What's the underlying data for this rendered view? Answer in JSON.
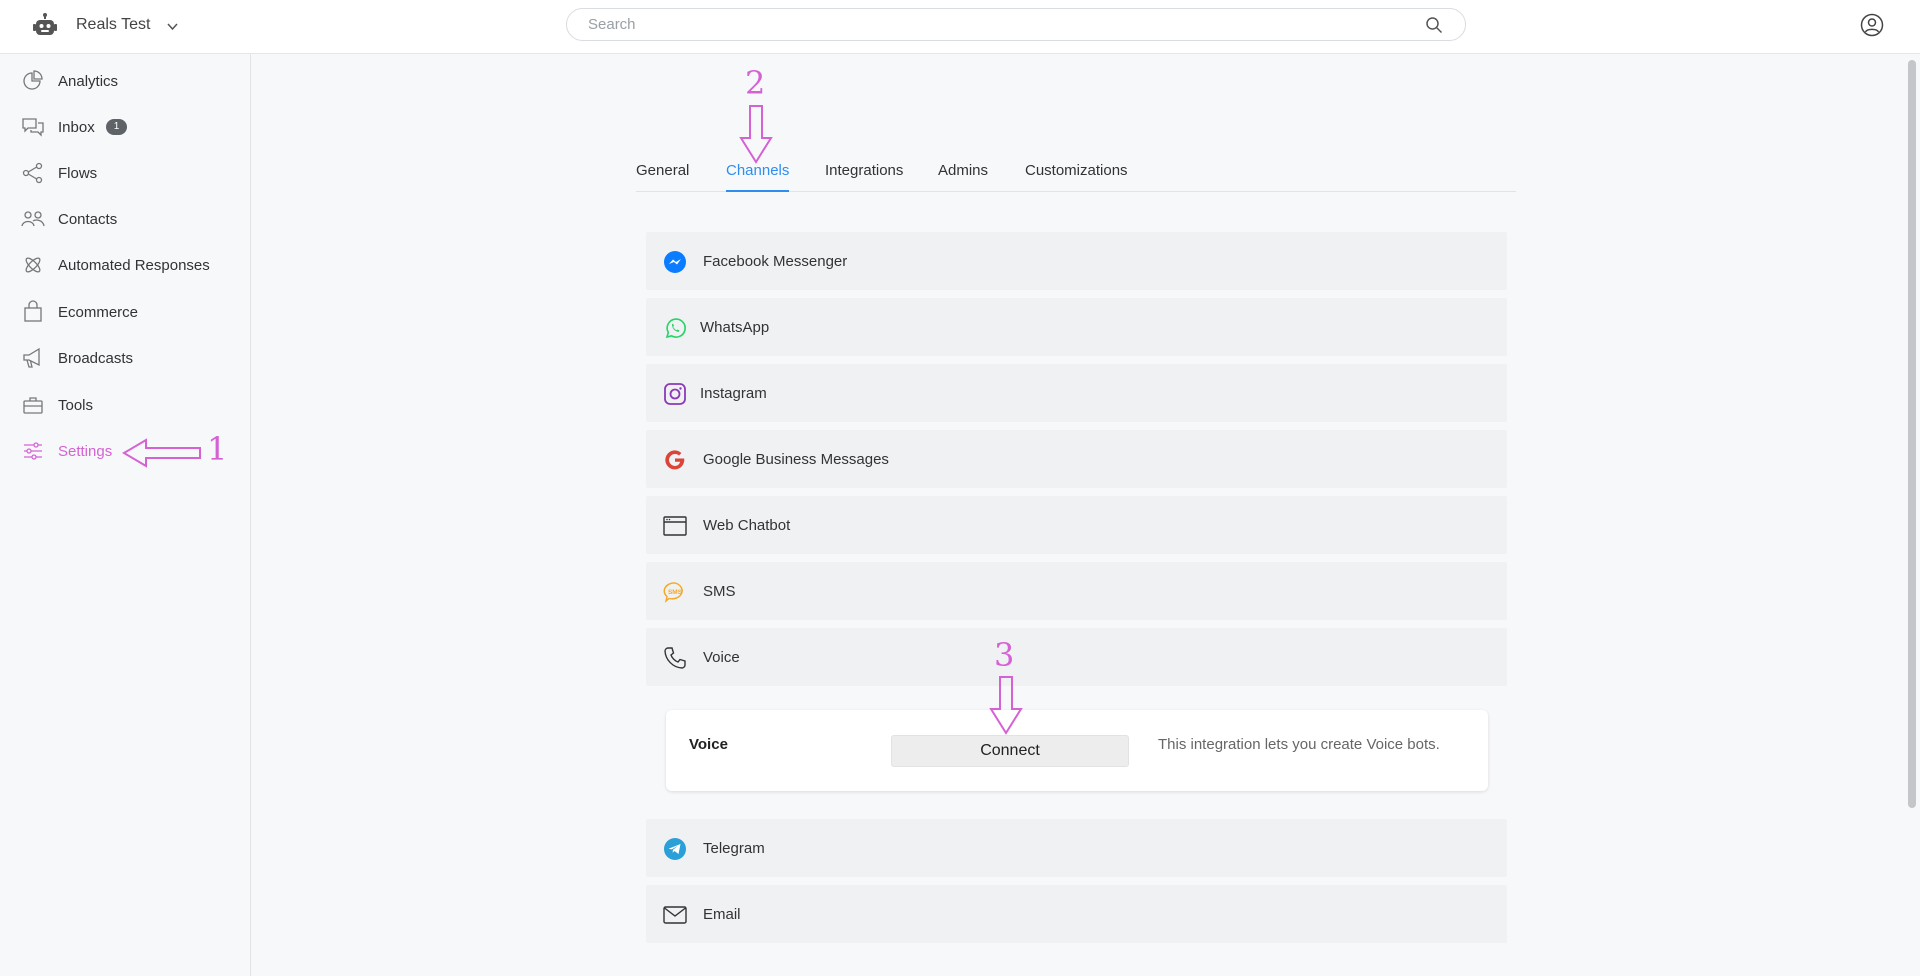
{
  "header": {
    "workspace_name": "Reals Test",
    "search_placeholder": "Search"
  },
  "sidebar": {
    "items": [
      {
        "label": "Analytics",
        "icon": "pie-chart-icon"
      },
      {
        "label": "Inbox",
        "icon": "chat-bubbles-icon",
        "badge": "1"
      },
      {
        "label": "Flows",
        "icon": "flow-nodes-icon"
      },
      {
        "label": "Contacts",
        "icon": "people-icon"
      },
      {
        "label": "Automated Responses",
        "icon": "atom-icon"
      },
      {
        "label": "Ecommerce",
        "icon": "shopping-bag-icon"
      },
      {
        "label": "Broadcasts",
        "icon": "megaphone-icon"
      },
      {
        "label": "Tools",
        "icon": "toolbox-icon"
      },
      {
        "label": "Settings",
        "icon": "sliders-icon",
        "active": true
      }
    ]
  },
  "tabs": [
    {
      "label": "General"
    },
    {
      "label": "Channels",
      "active": true
    },
    {
      "label": "Integrations"
    },
    {
      "label": "Admins"
    },
    {
      "label": "Customizations"
    }
  ],
  "channels": [
    {
      "label": "Facebook Messenger",
      "icon": "messenger-icon"
    },
    {
      "label": "WhatsApp",
      "icon": "whatsapp-icon"
    },
    {
      "label": "Instagram",
      "icon": "instagram-icon"
    },
    {
      "label": "Google Business Messages",
      "icon": "google-icon"
    },
    {
      "label": "Web Chatbot",
      "icon": "browser-window-icon"
    },
    {
      "label": "SMS",
      "icon": "sms-bubble-icon"
    },
    {
      "label": "Voice",
      "icon": "phone-icon"
    },
    {
      "label": "Telegram",
      "icon": "telegram-icon"
    },
    {
      "label": "Email",
      "icon": "envelope-icon"
    }
  ],
  "voice_panel": {
    "title": "Voice",
    "button_label": "Connect",
    "description": "This integration lets you create Voice bots."
  },
  "annotations": {
    "step1": "1",
    "step2": "2",
    "step3": "3",
    "color": "#d562d5"
  },
  "colors": {
    "accent": "#2e8ef0",
    "settings_active": "#d562d5"
  }
}
